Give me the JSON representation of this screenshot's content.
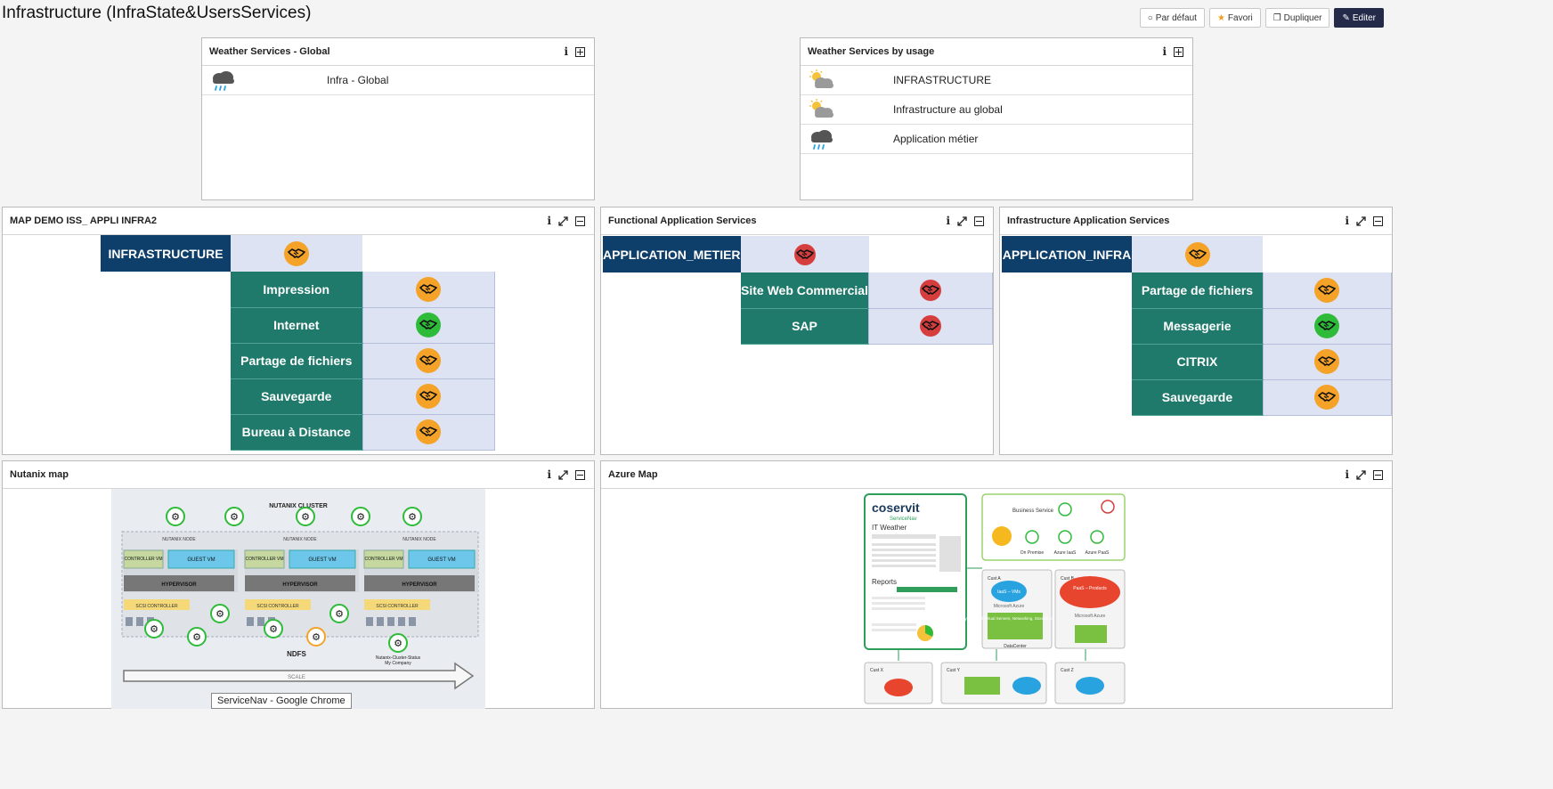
{
  "page": {
    "title": "Infrastructure (InfraState&UsersServices)"
  },
  "actions": {
    "default_label": "Par défaut",
    "favorite_label": "Favori",
    "duplicate_label": "Dupliquer",
    "edit_label": "Editer"
  },
  "weather_global": {
    "title": "Weather Services - Global",
    "rows": [
      {
        "label": "Infra - Global",
        "weather": "rain-icon"
      }
    ]
  },
  "weather_usage": {
    "title": "Weather Services by usage",
    "rows": [
      {
        "label": "INFRASTRUCTURE",
        "weather": "partly-cloudy-icon"
      },
      {
        "label": "Infrastructure au global",
        "weather": "partly-cloudy-icon"
      },
      {
        "label": "Application métier",
        "weather": "rain-icon"
      }
    ]
  },
  "map_demo": {
    "title": "MAP DEMO ISS_ APPLI INFRA2",
    "root": {
      "label": "INFRASTRUCTURE",
      "status": "orange"
    },
    "children": [
      {
        "label": "Impression",
        "status": "orange"
      },
      {
        "label": "Internet",
        "status": "green"
      },
      {
        "label": "Partage de fichiers",
        "status": "orange"
      },
      {
        "label": "Sauvegarde",
        "status": "orange"
      },
      {
        "label": "Bureau à Distance",
        "status": "orange"
      }
    ]
  },
  "functional": {
    "title": "Functional Application Services",
    "root": {
      "label": "APPLICATION_METIER",
      "status": "red"
    },
    "children": [
      {
        "label": "Site Web Commercial",
        "status": "red"
      },
      {
        "label": "SAP",
        "status": "red"
      }
    ]
  },
  "infra_app": {
    "title": "Infrastructure Application Services",
    "root": {
      "label": "APPLICATION_INFRA",
      "status": "orange"
    },
    "children": [
      {
        "label": "Partage de fichiers",
        "status": "orange"
      },
      {
        "label": "Messagerie",
        "status": "green"
      },
      {
        "label": "CITRIX",
        "status": "orange"
      },
      {
        "label": "Sauvegarde",
        "status": "orange"
      }
    ]
  },
  "nutanix": {
    "title": "Nutanix map",
    "diagram": {
      "cluster_label": "NUTANIX CLUSTER",
      "node_label": "NUTANIX NODE",
      "controller_label": "CONTROLLER VM",
      "guest_label": "GUEST VM",
      "hypervisor_label": "HYPERVISOR",
      "scsi_label": "SCSI CONTROLLER",
      "ndfs_label": "NDFS",
      "scale_label": "SCALE",
      "company_label": "My Company",
      "status_label": "Nutanix-Cluster-Status"
    }
  },
  "azure": {
    "title": "Azure Map",
    "diagram": {
      "brand": "coservit",
      "product": "ServiceNav",
      "it_weather": "IT Weather",
      "reports": "Reports",
      "business_service": "Business Service",
      "on_premise": "On Premise",
      "azure_iaas": "Azure IaaS",
      "azure_paas": "Azure PaaS",
      "cust_a": "Cust A",
      "cust_b": "Cust B",
      "cust_x": "Cust X",
      "cust_y": "Cust Y",
      "cust_z": "Cust Z",
      "iaas_vms": "IaaS – VMs",
      "microsoft_azure": "Microsoft Azure",
      "paas_products": "PaaS – Products",
      "datacenter": "DataCenter",
      "physical_virtual": "Physical and Virtual Servers, Networking, Storage, OS & Apps"
    }
  },
  "tooltip": "ServiceNav - Google Chrome",
  "colors": {
    "head_blue": "#0e3e6a",
    "teal": "#1f7a6b",
    "status_orange": "#f5a328",
    "status_green": "#2ebb3a",
    "status_red": "#d63e3e",
    "edit_button": "#232a4a"
  }
}
